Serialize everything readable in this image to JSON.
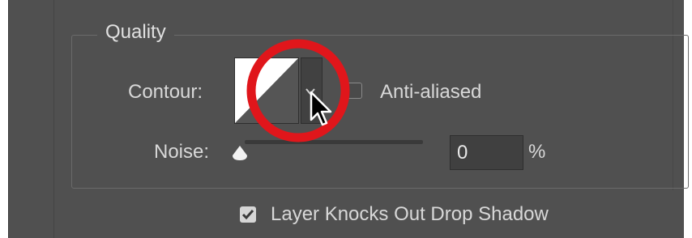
{
  "section": {
    "title": "Quality"
  },
  "contour": {
    "label": "Contour:",
    "anti_aliased_label": "Anti-aliased",
    "anti_aliased_checked": false
  },
  "noise": {
    "label": "Noise:",
    "value": "0",
    "unit": "%",
    "slider_fraction": 0
  },
  "layer_knocks_out": {
    "label": "Layer Knocks Out Drop Shadow",
    "checked": true
  },
  "colors": {
    "panel_bg": "#505050",
    "annotation_red": "#e0161b"
  },
  "icons": {
    "contour_dropdown": "chevron-down-icon",
    "checkmark": "checkmark-icon",
    "slider_thumb": "slider-thumb-icon",
    "annotation": "red-circle-annotation",
    "cursor": "mouse-pointer-icon"
  }
}
